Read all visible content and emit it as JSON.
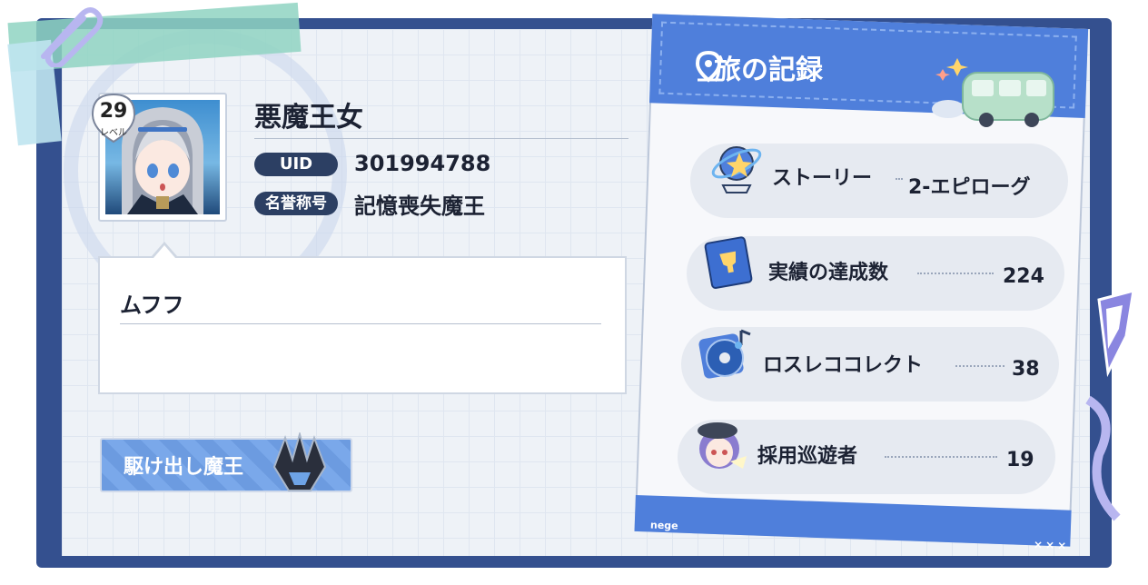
{
  "profile": {
    "level": "29",
    "level_label": "レベル",
    "name": "悪魔王女",
    "uid_label": "UID",
    "uid": "301994788",
    "title_label": "名誉称号",
    "title": "記憶喪失魔王",
    "comment": "ムフフ"
  },
  "badge": {
    "label": "駆け出し魔王",
    "icon": "crown-emblem-icon"
  },
  "travel_record": {
    "title": "旅の記録",
    "icon": "location-pin-icon",
    "brand": "nege",
    "footer_marks": "×××",
    "rows": [
      {
        "label": "ストーリー",
        "value": "2-エピローグ",
        "icon": "story-orbit-icon"
      },
      {
        "label": "実績の達成数",
        "value": "224",
        "icon": "achievement-book-icon"
      },
      {
        "label": "ロスレココレクト",
        "value": "38",
        "icon": "music-disc-icon"
      },
      {
        "label": "採用巡遊者",
        "value": "19",
        "icon": "character-portrait-icon"
      }
    ]
  },
  "colors": {
    "frame": "#34508f",
    "accent": "#4f7fdb",
    "pill": "#2c3f63"
  }
}
